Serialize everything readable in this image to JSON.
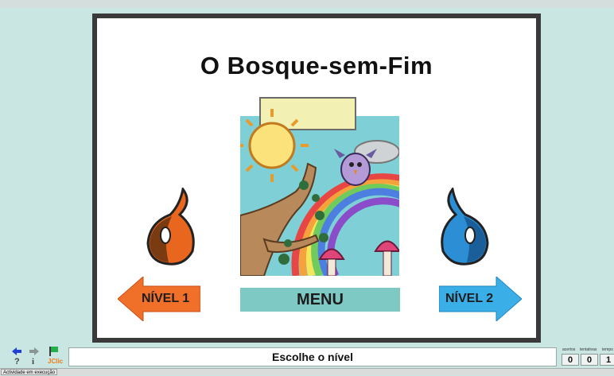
{
  "activity": {
    "title": "O Bosque-sem-Fim",
    "menu_label": "MENU",
    "level1_label": "NÍVEL 1",
    "level2_label": "NÍVEL 2"
  },
  "colors": {
    "level1_arrow": "#f07029",
    "level2_arrow": "#3aaee6",
    "menu_bg": "#7fc9c4",
    "frame": "#3a3a3a",
    "background": "#c9e6e2"
  },
  "toolbar": {
    "icons": [
      "blue-arrow-icon",
      "gray-arrow-icon",
      "green-flag-icon",
      "help-icon",
      "info-icon",
      "jclic-logo"
    ],
    "help_glyph": "?",
    "info_glyph": "i",
    "jclic_label": "JClic"
  },
  "status": {
    "message": "Escolhe o nível",
    "footer": "Actividade em execução"
  },
  "counters": [
    {
      "label": "acertos",
      "value": "0"
    },
    {
      "label": "tentativas",
      "value": "0"
    },
    {
      "label": "tempo",
      "value": "1"
    }
  ]
}
